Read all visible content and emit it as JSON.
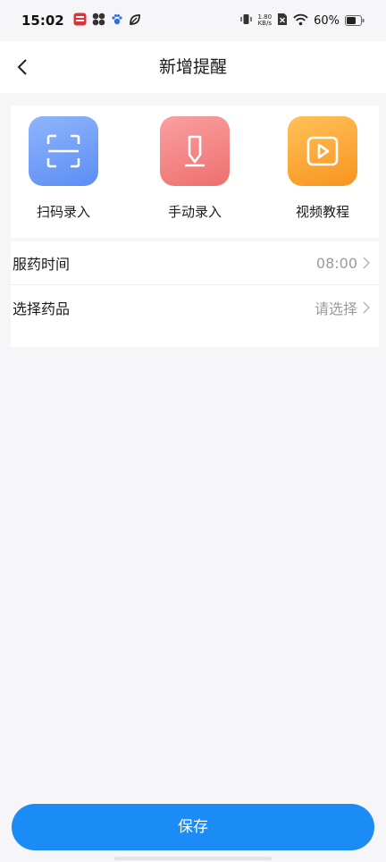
{
  "status_bar": {
    "time": "15:02",
    "net_speed_value": "1.80",
    "net_speed_unit": "KB/s",
    "battery_percent": "60%"
  },
  "header": {
    "title": "新增提醒"
  },
  "actions": [
    {
      "label": "扫码录入",
      "icon": "scan-icon"
    },
    {
      "label": "手动录入",
      "icon": "pen-icon"
    },
    {
      "label": "视频教程",
      "icon": "video-play-icon"
    }
  ],
  "form": {
    "time_label": "服药时间",
    "time_value": "08:00",
    "medicine_label": "选择药品",
    "medicine_value": "请选择"
  },
  "footer": {
    "save_label": "保存"
  },
  "colors": {
    "primary": "#1b8cf5",
    "scan_icon_bg": "#6f9df7",
    "manual_icon_bg": "#f28585",
    "video_icon_bg": "#fbaa3a"
  }
}
